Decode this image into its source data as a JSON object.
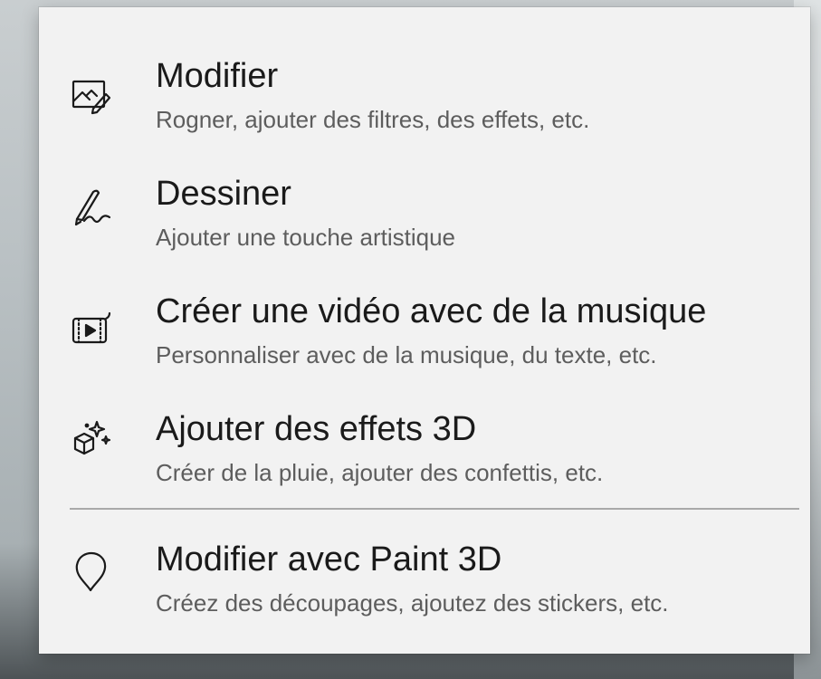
{
  "menu": {
    "items": [
      {
        "title": "Modifier",
        "subtitle": "Rogner, ajouter des filtres, des effets, etc.",
        "icon": "photo-edit-icon"
      },
      {
        "title": "Dessiner",
        "subtitle": "Ajouter une touche artistique",
        "icon": "pen-draw-icon"
      },
      {
        "title": "Créer une vidéo avec de la musique",
        "subtitle": "Personnaliser avec de la musique, du texte, etc.",
        "icon": "video-film-icon"
      },
      {
        "title": "Ajouter des effets 3D",
        "subtitle": "Créer de la pluie, ajouter des confettis, etc.",
        "icon": "3d-effects-icon"
      },
      {
        "title": "Modifier avec Paint 3D",
        "subtitle": "Créez des découpages, ajoutez des stickers, etc.",
        "icon": "paint3d-icon"
      }
    ]
  },
  "colors": {
    "menu_background": "#f2f2f2",
    "title_text": "#1a1a1a",
    "subtitle_text": "#5d5d5d",
    "separator": "#a9a9a9"
  }
}
